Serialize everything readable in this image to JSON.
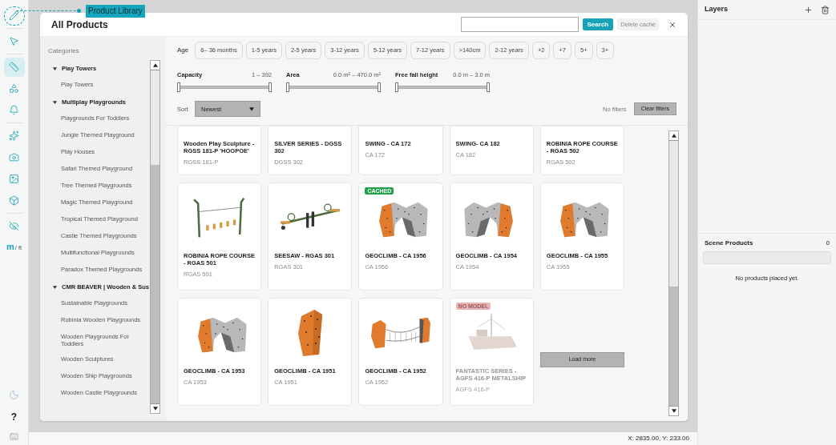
{
  "tooltip": "Product Library",
  "toolbar": {
    "top": [
      {
        "selected": false
      },
      {
        "selected": false
      },
      {
        "selected": true
      },
      {
        "selected": false
      },
      {
        "selected": false
      },
      {
        "selected": false
      },
      {
        "selected": false
      },
      {
        "selected": false
      },
      {
        "selected": false
      },
      {
        "selected": false
      }
    ],
    "units": {
      "primary": "m",
      "secondary": "/ ft"
    },
    "help": "?"
  },
  "modal": {
    "title": "All Products",
    "search_button": "Search",
    "delete_cache": {
      "label": "Delete cache",
      "disabled": true
    }
  },
  "categories": {
    "heading": "Categories",
    "groups": [
      {
        "label": "Play Towers",
        "expanded": true,
        "children": [
          {
            "label": "Play Towers"
          }
        ]
      },
      {
        "label": "Multiplay Playgrounds",
        "expanded": true,
        "children": [
          {
            "label": "Playgrounds For Toddlers"
          },
          {
            "label": "Jungle Themed Playground"
          },
          {
            "label": "Play Houses"
          },
          {
            "label": "Safari Themed Playground"
          },
          {
            "label": "Tree Themed Playgrounds"
          },
          {
            "label": "Magic Themed Playground"
          },
          {
            "label": "Tropical Themed Playground"
          },
          {
            "label": "Castle Themed Playgrounds"
          },
          {
            "label": "Multifunctional Playgrounds"
          },
          {
            "label": "Paradox Themed Playgrounds"
          }
        ]
      },
      {
        "label": "CMR BEAVER | Wooden & Sus",
        "expanded": true,
        "children": [
          {
            "label": "Sustainable Playgrounds"
          },
          {
            "label": "Robinia Wooden Playgrounds"
          },
          {
            "label": "Wooden Playgrounds For Toddlers"
          },
          {
            "label": "Wooden Sculptures"
          },
          {
            "label": "Wooden Ship Playgrounds"
          },
          {
            "label": "Wooden  Castle  Playgrounds"
          }
        ]
      }
    ]
  },
  "filters": {
    "age_label": "Age",
    "ages": [
      {
        "label": "6– 36 months",
        "selected": false
      },
      {
        "label": "1-5 years",
        "selected": false
      },
      {
        "label": "2-5 years",
        "selected": false
      },
      {
        "label": "3-12 years",
        "selected": false
      },
      {
        "label": "5-12 years",
        "selected": false
      },
      {
        "label": "7-12 years",
        "selected": false
      },
      {
        "label": ">140cm",
        "selected": false
      },
      {
        "label": "2-12 years",
        "selected": false
      },
      {
        "label": "+2",
        "selected": false
      },
      {
        "label": "+7",
        "selected": false
      },
      {
        "label": "5+",
        "selected": false
      },
      {
        "label": "3+",
        "selected": false
      }
    ],
    "ranges": [
      {
        "label": "Capacity",
        "reading": "1 – 392",
        "level": 1
      },
      {
        "label": "Area",
        "reading": "0.0 m² – 470.0 m²",
        "level": 1
      },
      {
        "label": "Free fall height",
        "reading": "0.0 m – 3.0 m",
        "level": 1
      }
    ],
    "sort_label": "Sort",
    "sort_value": "Newest",
    "status": "No filters",
    "clear": "Clear filters"
  },
  "products": [
    {
      "name": "Wooden Play Sculpture - RGSS 181-P 'HOOPOE'",
      "code": "RGSS 181-P",
      "kind": "text-only",
      "disabled": false
    },
    {
      "name": "SILVER SERIES - DGSS 302",
      "code": "DGSS 302",
      "kind": "text-only",
      "disabled": false
    },
    {
      "name": "SWING - CA 172",
      "code": "CA 172",
      "kind": "text-only",
      "disabled": false
    },
    {
      "name": "SWING- CA 182",
      "code": "CA 182",
      "kind": "text-only",
      "disabled": false
    },
    {
      "name": "ROBINIA ROPE COURSE - RGAS 502",
      "code": "RGAS 502",
      "kind": "text-only",
      "disabled": false
    },
    {
      "name": "ROBINIA ROPE COURSE - RGAS 501",
      "code": "RGAS 501",
      "kind": "rope",
      "disabled": false
    },
    {
      "name": "SEESAW - RGAS 301",
      "code": "RGAS 301",
      "kind": "seesaw",
      "disabled": false
    },
    {
      "name": "GEOCLIMB - CA 1956",
      "code": "CA 1956",
      "kind": "arch-left",
      "badge": {
        "kind": "cached",
        "text": "CACHED"
      },
      "disabled": false
    },
    {
      "name": "GEOCLIMB - CA 1954",
      "code": "CA 1954",
      "kind": "arch-right",
      "disabled": false
    },
    {
      "name": "GEOCLIMB - CA 1955",
      "code": "CA 1955",
      "kind": "arch-left",
      "disabled": false
    },
    {
      "name": "GEOCLIMB - CA 1953",
      "code": "CA 1953",
      "kind": "arch-left",
      "disabled": false
    },
    {
      "name": "GEOCLIMB - CA 1951",
      "code": "CA 1951",
      "kind": "block",
      "disabled": false
    },
    {
      "name": "GEOCLIMB - CA 1952",
      "code": "CA 1952",
      "kind": "bridge",
      "disabled": false
    },
    {
      "name": "FANTASTIC SERIES - AGFS 416-P METALSHIP",
      "code": "AGFS 416-P",
      "kind": "ship",
      "badge": {
        "kind": "no-model",
        "text": "NO MODEL"
      },
      "disabled": true
    }
  ],
  "load_more": "Load more",
  "layers": {
    "title": "Layers"
  },
  "scene_products": {
    "title": "Scene Products",
    "count": "0",
    "empty": "No products placed yet."
  },
  "status_bar": "X: 2835.00, Y: 233.00"
}
